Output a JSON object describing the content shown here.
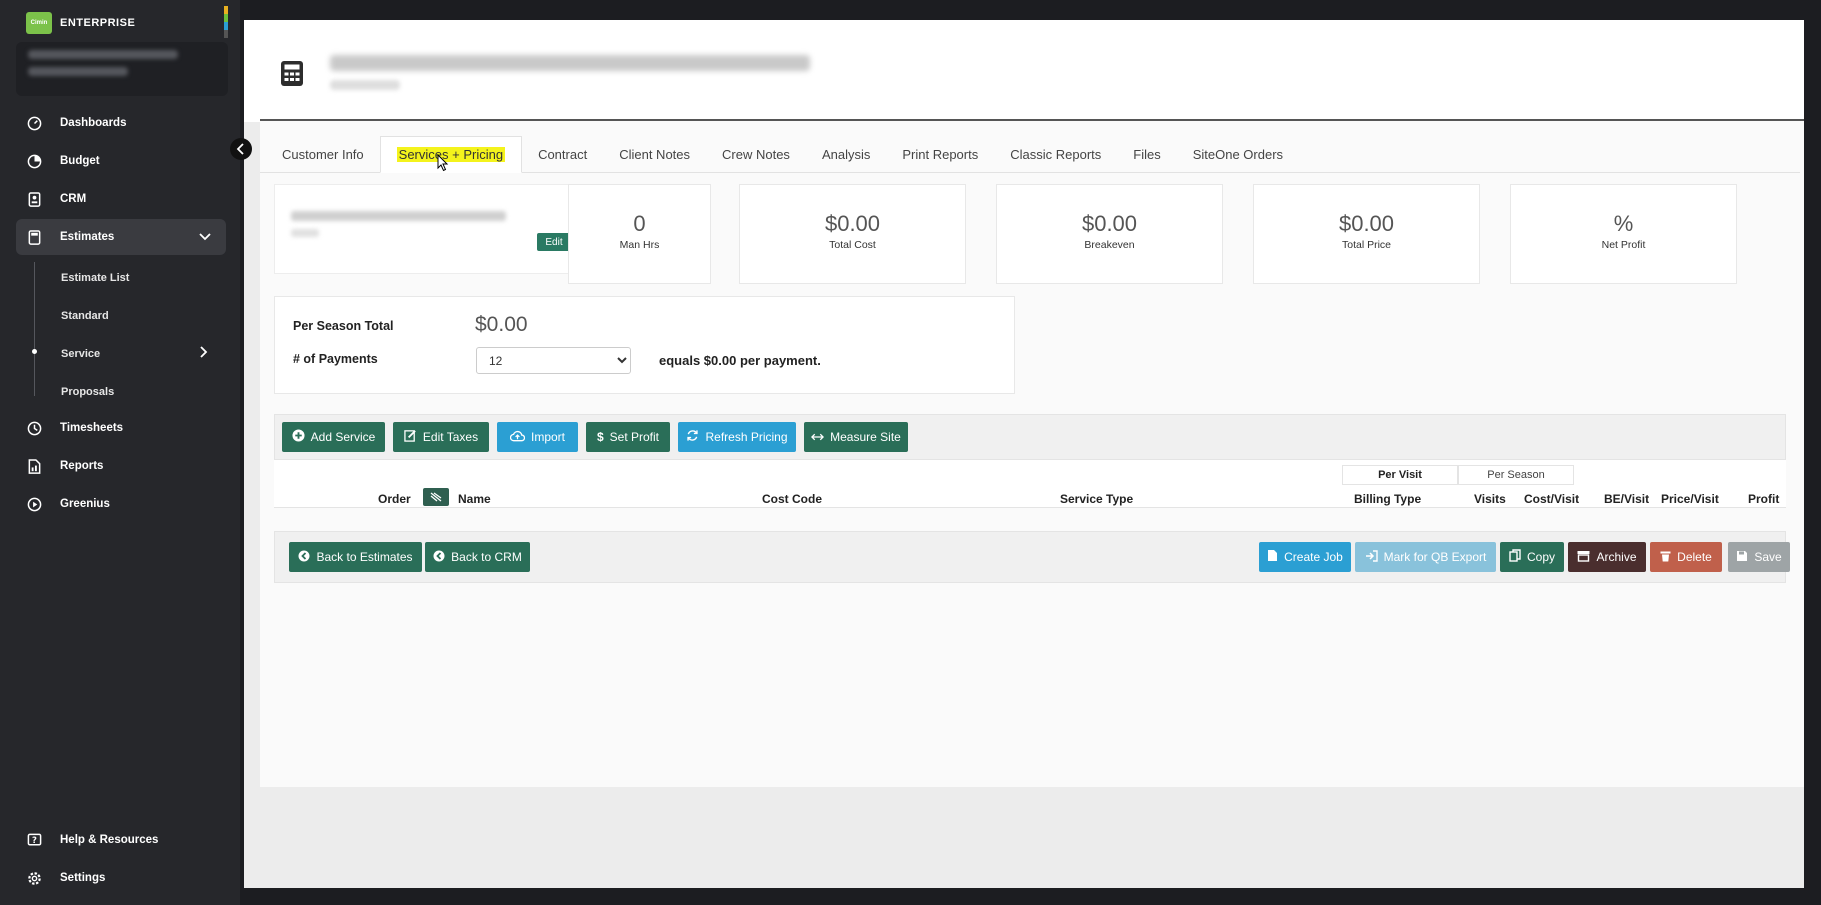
{
  "brand": {
    "name": "ENTERPRISE",
    "logo_text": "Cimin"
  },
  "sidebar": {
    "items": [
      {
        "label": "Dashboards",
        "icon": "dashboard-icon"
      },
      {
        "label": "Budget",
        "icon": "pie-chart-icon"
      },
      {
        "label": "CRM",
        "icon": "crm-icon"
      },
      {
        "label": "Estimates",
        "icon": "calculator-icon"
      },
      {
        "label": "Timesheets",
        "icon": "clock-icon"
      },
      {
        "label": "Reports",
        "icon": "report-icon"
      },
      {
        "label": "Greenius",
        "icon": "play-circle-icon"
      }
    ],
    "sub_items": [
      {
        "label": "Estimate List"
      },
      {
        "label": "Standard"
      },
      {
        "label": "Service"
      },
      {
        "label": "Proposals"
      }
    ],
    "bottom": [
      {
        "label": "Help & Resources",
        "icon": "help-icon"
      },
      {
        "label": "Settings",
        "icon": "gear-icon"
      }
    ]
  },
  "tabs": [
    {
      "label": "Customer Info"
    },
    {
      "label": "Services + Pricing",
      "active": true
    },
    {
      "label": "Contract"
    },
    {
      "label": "Client Notes"
    },
    {
      "label": "Crew Notes"
    },
    {
      "label": "Analysis"
    },
    {
      "label": "Print Reports"
    },
    {
      "label": "Classic Reports"
    },
    {
      "label": "Files"
    },
    {
      "label": "SiteOne Orders"
    }
  ],
  "customer_card": {
    "edit_label": "Edit"
  },
  "stats": [
    {
      "value": "0",
      "label": "Man Hrs"
    },
    {
      "value": "$0.00",
      "label": "Total Cost"
    },
    {
      "value": "$0.00",
      "label": "Breakeven"
    },
    {
      "value": "$0.00",
      "label": "Total Price"
    },
    {
      "value": "%",
      "label": "Net Profit"
    }
  ],
  "season": {
    "total_label": "Per Season Total",
    "total_value": "$0.00",
    "payments_label": "# of Payments",
    "payments_value": "12",
    "equals_text": "equals $0.00 per payment."
  },
  "toolbar": {
    "add_service": "Add Service",
    "edit_taxes": "Edit Taxes",
    "import": "Import",
    "set_profit": "Set Profit",
    "refresh_pricing": "Refresh Pricing",
    "measure_site": "Measure Site"
  },
  "table": {
    "per_visit": "Per Visit",
    "per_season": "Per Season",
    "columns": {
      "order": "Order",
      "name": "Name",
      "cost_code": "Cost Code",
      "service_type": "Service Type",
      "billing_type": "Billing Type",
      "visits": "Visits",
      "cost_visit": "Cost/Visit",
      "be_visit": "BE/Visit",
      "price_visit": "Price/Visit",
      "profit": "Profit"
    }
  },
  "footer": {
    "back_estimates": "Back to Estimates",
    "back_crm": "Back to CRM",
    "create_job": "Create Job",
    "mark_qb": "Mark for QB Export",
    "copy": "Copy",
    "archive": "Archive",
    "delete": "Delete",
    "save": "Save"
  },
  "colors": {
    "sidebar_bg": "#26272b",
    "accent_green": "#2a6e58",
    "accent_blue": "#2b9fd3",
    "highlight": "#f4f31c"
  }
}
